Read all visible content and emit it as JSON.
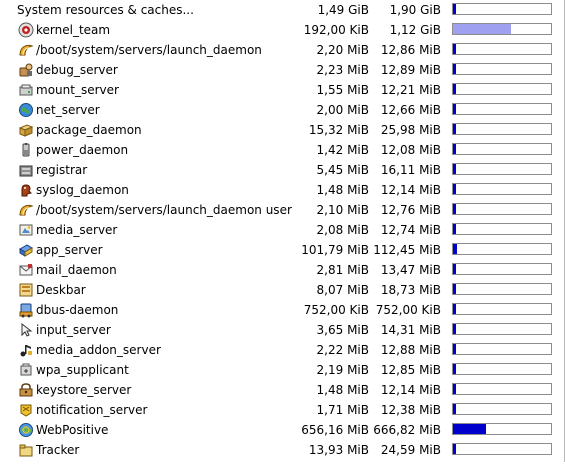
{
  "system": {
    "label": "System resources & caches...",
    "used": "1,49 GiB",
    "total": "1,90 GiB",
    "usage_percent": 3,
    "color": "#0000cc"
  },
  "processes": [
    {
      "name": "kernel_team",
      "used": "192,00 KiB",
      "total": "1,12 GiB",
      "usage_percent": 59,
      "color": "#a0a0f0",
      "icon": "kernel-icon"
    },
    {
      "name": "/boot/system/servers/launch_daemon",
      "used": "2,20 MiB",
      "total": "12,86 MiB",
      "usage_percent": 0,
      "color": "#0000cc",
      "icon": "launch-daemon-icon"
    },
    {
      "name": "debug_server",
      "used": "2,23 MiB",
      "total": "12,89 MiB",
      "usage_percent": 0,
      "color": "#0000cc",
      "icon": "debug-server-icon"
    },
    {
      "name": "mount_server",
      "used": "1,55 MiB",
      "total": "12,21 MiB",
      "usage_percent": 0,
      "color": "#0000cc",
      "icon": "mount-server-icon"
    },
    {
      "name": "net_server",
      "used": "2,00 MiB",
      "total": "12,66 MiB",
      "usage_percent": 0,
      "color": "#0000cc",
      "icon": "net-server-icon"
    },
    {
      "name": "package_daemon",
      "used": "15,32 MiB",
      "total": "25,98 MiB",
      "usage_percent": 2,
      "color": "#0000cc",
      "icon": "package-daemon-icon"
    },
    {
      "name": "power_daemon",
      "used": "1,42 MiB",
      "total": "12,08 MiB",
      "usage_percent": 0,
      "color": "#0000cc",
      "icon": "power-daemon-icon"
    },
    {
      "name": "registrar",
      "used": "5,45 MiB",
      "total": "16,11 MiB",
      "usage_percent": 0,
      "color": "#0000cc",
      "icon": "registrar-icon"
    },
    {
      "name": "syslog_daemon",
      "used": "1,48 MiB",
      "total": "12,14 MiB",
      "usage_percent": 0,
      "color": "#0000cc",
      "icon": "syslog-daemon-icon"
    },
    {
      "name": "/boot/system/servers/launch_daemon user",
      "used": "2,10 MiB",
      "total": "12,76 MiB",
      "usage_percent": 0,
      "color": "#0000cc",
      "icon": "launch-daemon-user-icon"
    },
    {
      "name": "media_server",
      "used": "2,08 MiB",
      "total": "12,74 MiB",
      "usage_percent": 0,
      "color": "#0000cc",
      "icon": "media-server-icon"
    },
    {
      "name": "app_server",
      "used": "101,79 MiB",
      "total": "112,45 MiB",
      "usage_percent": 4,
      "color": "#0000cc",
      "icon": "app-server-icon"
    },
    {
      "name": "mail_daemon",
      "used": "2,81 MiB",
      "total": "13,47 MiB",
      "usage_percent": 0,
      "color": "#0000cc",
      "icon": "mail-daemon-icon"
    },
    {
      "name": "Deskbar",
      "used": "8,07 MiB",
      "total": "18,73 MiB",
      "usage_percent": 0,
      "color": "#0000cc",
      "icon": "deskbar-icon"
    },
    {
      "name": "dbus-daemon",
      "used": "752,00 KiB",
      "total": "752,00 KiB",
      "usage_percent": 0,
      "color": "#0000cc",
      "icon": "dbus-daemon-icon"
    },
    {
      "name": "input_server",
      "used": "3,65 MiB",
      "total": "14,31 MiB",
      "usage_percent": 0,
      "color": "#0000cc",
      "icon": "input-server-icon"
    },
    {
      "name": "media_addon_server",
      "used": "2,22 MiB",
      "total": "12,88 MiB",
      "usage_percent": 0,
      "color": "#0000cc",
      "icon": "media-addon-server-icon"
    },
    {
      "name": "wpa_supplicant",
      "used": "2,19 MiB",
      "total": "12,85 MiB",
      "usage_percent": 0,
      "color": "#0000cc",
      "icon": "wpa-supplicant-icon"
    },
    {
      "name": "keystore_server",
      "used": "1,48 MiB",
      "total": "12,14 MiB",
      "usage_percent": 0,
      "color": "#0000cc",
      "icon": "keystore-server-icon"
    },
    {
      "name": "notification_server",
      "used": "1,71 MiB",
      "total": "12,38 MiB",
      "usage_percent": 0,
      "color": "#0000cc",
      "icon": "notification-server-icon"
    },
    {
      "name": "WebPositive",
      "used": "656,16 MiB",
      "total": "666,82 MiB",
      "usage_percent": 34,
      "color": "#0000cc",
      "icon": "webpositive-icon"
    },
    {
      "name": "Tracker",
      "used": "13,93 MiB",
      "total": "24,59 MiB",
      "usage_percent": 1,
      "color": "#0000cc",
      "icon": "tracker-icon"
    }
  ]
}
